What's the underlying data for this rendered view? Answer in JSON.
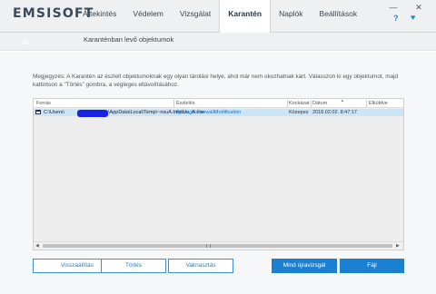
{
  "app": {
    "logo": "EMSISOFT"
  },
  "nav": {
    "tabs": [
      "Áttekintés",
      "Védelem",
      "Vizsgálat",
      "Karantén",
      "Naplók",
      "Beállítások"
    ],
    "active": "Karantén"
  },
  "window": {
    "minimize_glyph": "—",
    "close_glyph": "✕",
    "help_glyph": "?",
    "heart_glyph": "♥"
  },
  "subheader": {
    "title": "Karanténban levő objektumok"
  },
  "note": "Megjegyzés: A Karantén az észlelt objektumoknak egy olyan tárolási helye, ahol már nem okozhatnak kárt. Válasszon ki egy objektumot, majd kattintson a \"Törlés\" gombra, a végleges eltávolításához.",
  "table": {
    "columns": [
      "Forrás",
      "Észlelés",
      "Kockázat",
      "Dátum",
      "Elküldve"
    ],
    "rows": [
      {
        "path_start": "C:\\Users\\",
        "path_end": "\\AppData\\Local\\Temp\\~nsuA.tmp\\Un_A.exe",
        "detection": "Behavior.FirewallModification",
        "risk": "Közepes",
        "date": "2018.02.02. 8:47:17",
        "sent": ""
      }
    ]
  },
  "buttons": {
    "restore": "Visszaállítás",
    "delete": "Törlés",
    "send": "Vaknasztás",
    "fix_all": "Mind újravizsgál",
    "file": "Fájl"
  },
  "colors": {
    "accent": "#1d7fd0",
    "selection": "#cce4f7",
    "redaction": "#1a22e6"
  }
}
